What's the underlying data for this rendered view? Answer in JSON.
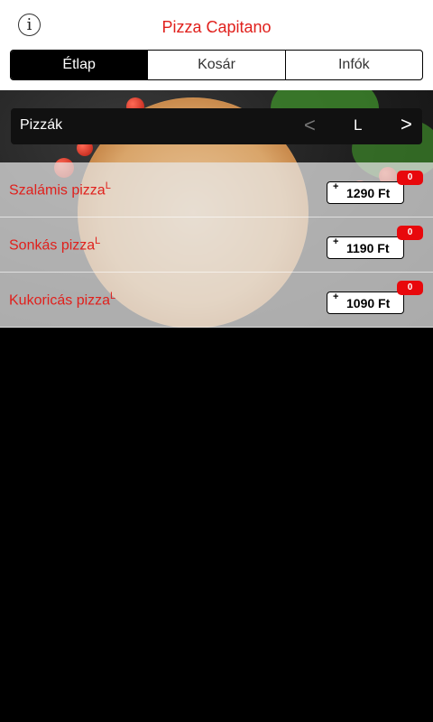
{
  "header": {
    "title": "Pizza Capitano",
    "info_icon": "i"
  },
  "tabs": [
    {
      "label": "Étlap",
      "active": true
    },
    {
      "label": "Kosár",
      "active": false
    },
    {
      "label": "Infók",
      "active": false
    }
  ],
  "category": {
    "label": "Pizzák",
    "prev": "<",
    "size": "L",
    "next": ">"
  },
  "items": [
    {
      "name": "Szalámis pizza",
      "size_mark": "L",
      "plus": "+",
      "price": "1290 Ft",
      "count": "0"
    },
    {
      "name": "Sonkás pizza",
      "size_mark": "L",
      "plus": "+",
      "price": "1190 Ft",
      "count": "0"
    },
    {
      "name": "Kukoricás pizza",
      "size_mark": "L",
      "plus": "+",
      "price": "1090 Ft",
      "count": "0"
    }
  ],
  "colors": {
    "accent": "#e0201c",
    "badge": "#e8080c"
  }
}
